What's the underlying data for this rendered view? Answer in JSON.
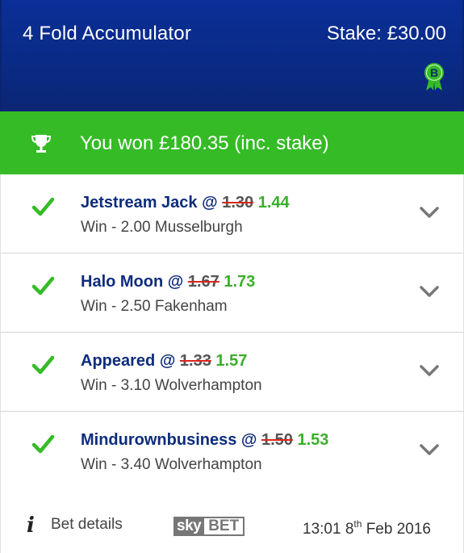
{
  "header": {
    "title": "4 Fold Accumulator",
    "stake": "Stake: £30.00",
    "badge_icon": "b-rosette-badge-icon",
    "badge_color": "#35bb26"
  },
  "result": {
    "text": "You won £180.35 (inc. stake)",
    "icon": "trophy-icon",
    "color": "#35bb26"
  },
  "selections": [
    {
      "name": "Jetstream Jack",
      "at": "@",
      "old_odds": "1.30",
      "new_odds": "1.44",
      "detail": "Win - 2.00 Musselburgh"
    },
    {
      "name": "Halo Moon",
      "at": "@",
      "old_odds": "1.67",
      "new_odds": "1.73",
      "detail": "Win - 2.50 Fakenham"
    },
    {
      "name": "Appeared",
      "at": "@",
      "old_odds": "1.33",
      "new_odds": "1.57",
      "detail": "Win - 3.10 Wolverhampton"
    },
    {
      "name": "Mindurownbusiness",
      "at": "@",
      "old_odds": "1.50",
      "new_odds": "1.53",
      "detail": "Win - 3.40 Wolverhampton"
    }
  ],
  "footer": {
    "info_icon": "i",
    "bet_details": "Bet details",
    "logo_sky": "sky",
    "logo_bet": "BET",
    "time": "13:01 8",
    "day_suffix": "th",
    "date_rest": " Feb 2016"
  }
}
